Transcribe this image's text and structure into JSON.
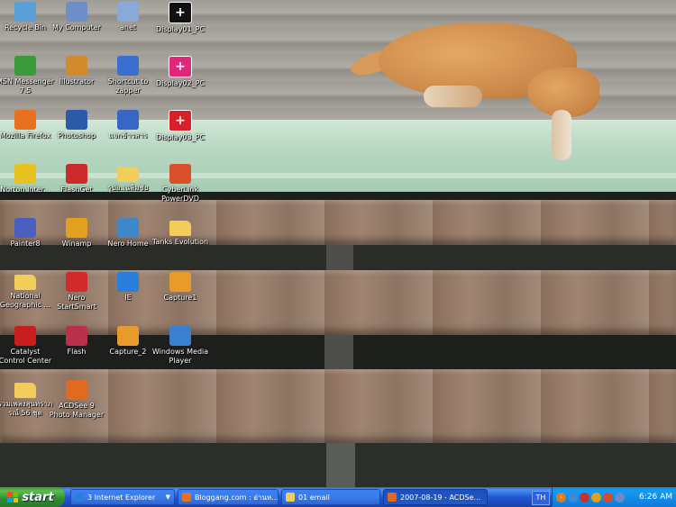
{
  "desktop": {
    "icons": [
      {
        "label": "Recycle Bin",
        "icon": "recycle-bin-icon",
        "color": "#5aa0d8"
      },
      {
        "label": "My Computer",
        "icon": "computer-icon",
        "color": "#6d8fc7"
      },
      {
        "label": "anet",
        "icon": "network-icon",
        "color": "#8aa8d8"
      },
      {
        "label": "Display01_PC",
        "icon": "display-icon",
        "color": "#111111"
      },
      {
        "label": "MSN Messenger 7.5",
        "icon": "msn-messenger-icon",
        "color": "#3a9b3a"
      },
      {
        "label": "Illustrator",
        "icon": "illustrator-icon",
        "color": "#d28a2c"
      },
      {
        "label": "Shortcut to zapper",
        "icon": "application-window-icon",
        "color": "#3b6fcf"
      },
      {
        "label": "Display02_PC",
        "icon": "display-icon",
        "color": "#e0287a"
      },
      {
        "label": "Mozilla Firefox",
        "icon": "firefox-icon",
        "color": "#e8701f"
      },
      {
        "label": "Photoshop",
        "icon": "photoshop-icon",
        "color": "#2a5aa8"
      },
      {
        "label": "แจกข้าวสาร",
        "icon": "word-document-icon",
        "color": "#3766c4"
      },
      {
        "label": "Display03_PC",
        "icon": "display-icon",
        "color": "#d8202a"
      },
      {
        "label": "Norton Inter...",
        "icon": "norton-icon",
        "color": "#e8c21f"
      },
      {
        "label": "FlashGet",
        "icon": "flashget-icon",
        "color": "#cc2a2a"
      },
      {
        "label": "รูปอ.เฉลิมชัย",
        "icon": "folder-icon",
        "color": "#f2cd5a"
      },
      {
        "label": "CyberLink PowerDVD",
        "icon": "powerdvd-icon",
        "color": "#d9502a"
      },
      {
        "label": "Painter8",
        "icon": "painter-icon",
        "color": "#4b5fbf"
      },
      {
        "label": "Winamp",
        "icon": "winamp-icon",
        "color": "#e2a020"
      },
      {
        "label": "Nero Home",
        "icon": "nero-home-icon",
        "color": "#3f87c9"
      },
      {
        "label": "Tanks Evolution",
        "icon": "folder-icon",
        "color": "#f2cd5a"
      },
      {
        "label": "National Geographic ...",
        "icon": "folder-icon",
        "color": "#f2cd5a"
      },
      {
        "label": "Nero StartSmart",
        "icon": "nero-icon",
        "color": "#d22a2a"
      },
      {
        "label": "IE",
        "icon": "internet-explorer-icon",
        "color": "#2a7fdc"
      },
      {
        "label": "Capture1",
        "icon": "jpeg-image-icon",
        "color": "#e89a2a"
      },
      {
        "label": "Catalyst Control Center",
        "icon": "ati-icon",
        "color": "#c81e1e"
      },
      {
        "label": "Flash",
        "icon": "flash-icon",
        "color": "#b8304a"
      },
      {
        "label": "Capture_2",
        "icon": "jpeg-image-icon",
        "color": "#e89a2a"
      },
      {
        "label": "Windows Media Player",
        "icon": "media-player-icon",
        "color": "#3a7fd0"
      },
      {
        "label": "รวมเพลงสุนทราภรณ์ 56 ชุด",
        "icon": "folder-icon",
        "color": "#f2cd5a"
      },
      {
        "label": "ACDSee 9 Photo Manager",
        "icon": "acdsee-icon",
        "color": "#e06a20"
      }
    ]
  },
  "taskbar": {
    "start_label": "start",
    "tasks": [
      {
        "label": "3 Internet Explorer",
        "icon": "internet-explorer-icon",
        "color": "#2a7fdc",
        "has_menu": true
      },
      {
        "label": "Bloggang.com : อ่านห...",
        "icon": "firefox-icon",
        "color": "#e8701f",
        "has_menu": false
      },
      {
        "label": "01 email",
        "icon": "folder-icon",
        "color": "#f2cd5a",
        "has_menu": false
      },
      {
        "label": "2007-08-19 - ACDSe...",
        "icon": "acdsee-icon",
        "color": "#e06a20",
        "has_menu": false
      }
    ],
    "language": "TH",
    "clock": "6:26 AM"
  }
}
